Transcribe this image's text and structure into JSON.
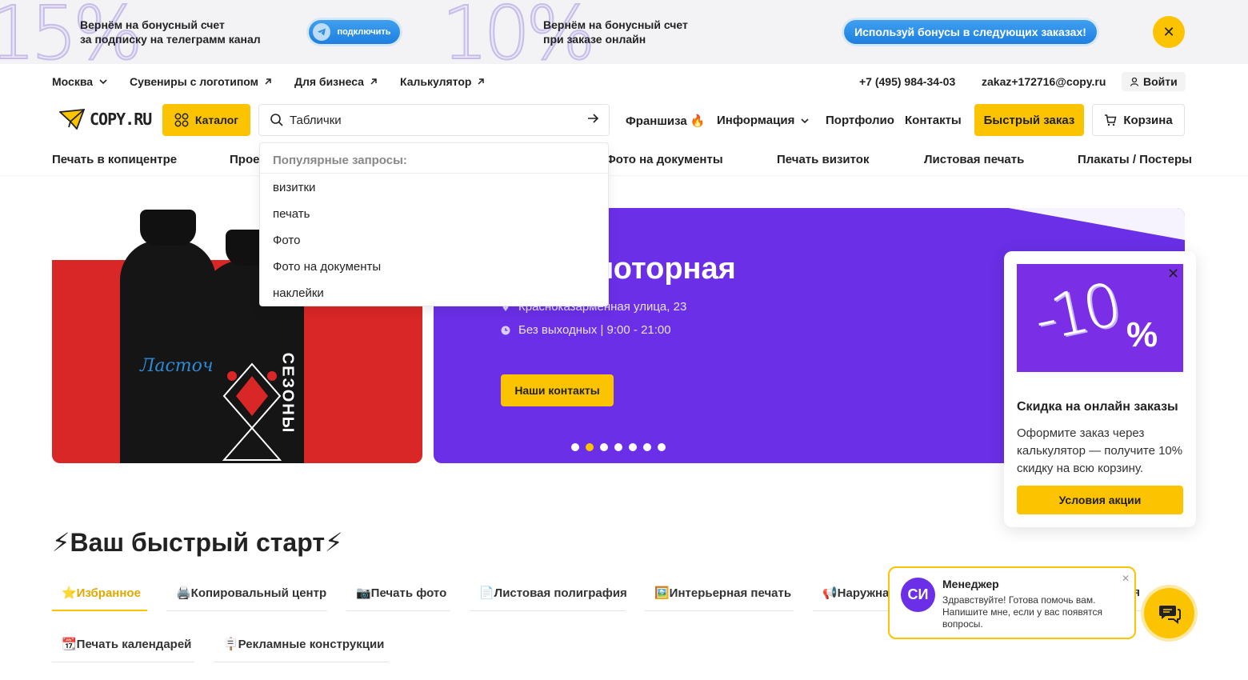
{
  "promo": {
    "big_left": "15%",
    "text_left_1": "Вернём на бонусный счет",
    "text_left_2": "за подписку на телеграмм канал",
    "connect_label": "подключить",
    "big_right": "10%",
    "text_right_1": "Вернём на бонусный счет",
    "text_right_2": "при заказе онлайн",
    "bonus_label": "Используй бонусы в следующих заказах!"
  },
  "topnav": {
    "city": "Москва",
    "links": [
      "Сувениры с логотипом",
      "Для бизнеса",
      "Калькулятор"
    ],
    "phone": "+7 (495) 984-34-03",
    "email": "zakaz+172716@copy.ru",
    "login": "Войти"
  },
  "header": {
    "logo": "COPY.RU",
    "catalog": "Каталог",
    "search_value": "Таблички",
    "franchise": "Франшиза 🔥",
    "info": "Информация",
    "portfolio": "Портфолио",
    "contacts": "Контакты",
    "fast_order": "Быстрый заказ",
    "cart": "Корзина"
  },
  "subnav": [
    "Печать в копицентре",
    "Прое",
    "Фото на документы",
    "Печать визиток",
    "Листовая печать",
    "Плакаты / Постеры"
  ],
  "dropdown": {
    "header": "Популярные запросы:",
    "items": [
      "визитки",
      "печать",
      "Фото",
      "Фото на документы",
      "наклейки"
    ]
  },
  "banner_left": {
    "label": "Ласточ",
    "print": "СЕЗОНЫ"
  },
  "banner_right": {
    "title": "амоторная",
    "address": "Красноказарменная улица, 23",
    "hours": "Без выходных  |  9:00 - 21:00",
    "button": "Наши контакты",
    "active_slide": 1,
    "slides": 7
  },
  "popup": {
    "big": "-10",
    "pct": "%",
    "title": "Скидка на онлайн заказы",
    "text": "Оформите заказ через калькулятор — получите 10% скидку на всю корзину.",
    "button": "Условия акции"
  },
  "quickstart": {
    "title": "⚡Ваш быстрый старт⚡",
    "tabs": [
      "⭐Избранное",
      "🖨️Копировальный центр",
      "📷Печать фото",
      "📄Листовая полиграфия",
      "🖼️Интерьерная печать",
      "📢Наружна",
      "ия",
      "📆Печать календарей",
      "🪧Рекламные конструкции"
    ]
  },
  "chat": {
    "avatar": "СИ",
    "name": "Менеджер",
    "message": "Здравствуйте! Готова помочь вам. Напишите мне, если у вас появятся вопросы."
  },
  "colors": {
    "accent": "#fcc400",
    "purple": "#6a2fe6",
    "red": "#d92626"
  }
}
